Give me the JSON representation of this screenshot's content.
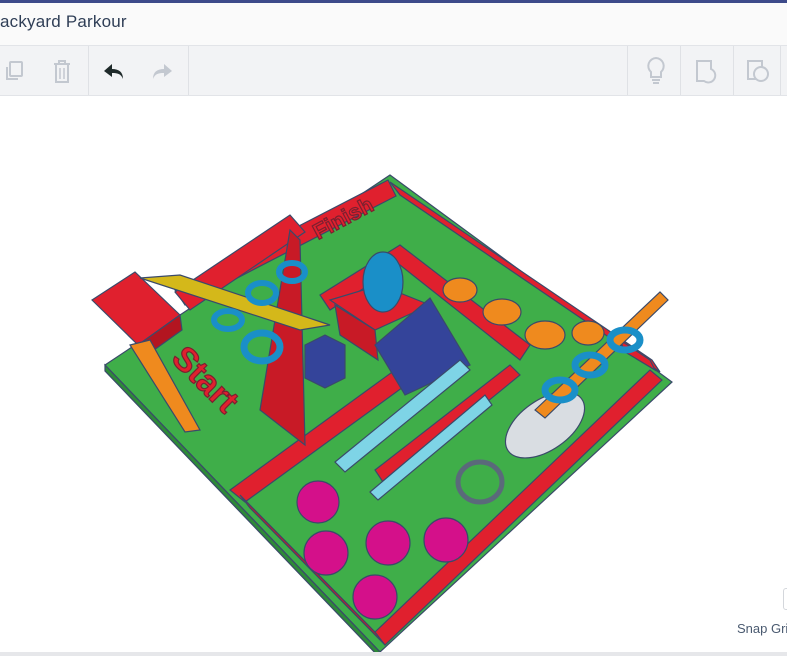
{
  "header": {
    "title": "ackyard Parkour"
  },
  "toolbar": {
    "left": [
      {
        "name": "copy",
        "icon": "copy-icon"
      },
      {
        "name": "delete",
        "icon": "trash-icon"
      },
      {
        "name": "undo",
        "icon": "undo-icon"
      },
      {
        "name": "redo",
        "icon": "redo-icon"
      }
    ],
    "right": [
      {
        "name": "notes",
        "icon": "lightbulb-icon"
      },
      {
        "name": "show-hidden",
        "icon": "shape-icon"
      },
      {
        "name": "show-all",
        "icon": "shape-outline-icon"
      }
    ]
  },
  "scene": {
    "start_label": "Start",
    "finish_label": "Finish"
  },
  "footer": {
    "snap_grid_label": "Snap Gri"
  },
  "colors": {
    "accent": "#3d4a8a",
    "green": "#3fae49",
    "red": "#e0202e",
    "yellow": "#d4b81a",
    "blue": "#1a8fc8",
    "orange": "#ef8a1e",
    "magenta": "#d4108a",
    "navy": "#34449a"
  }
}
